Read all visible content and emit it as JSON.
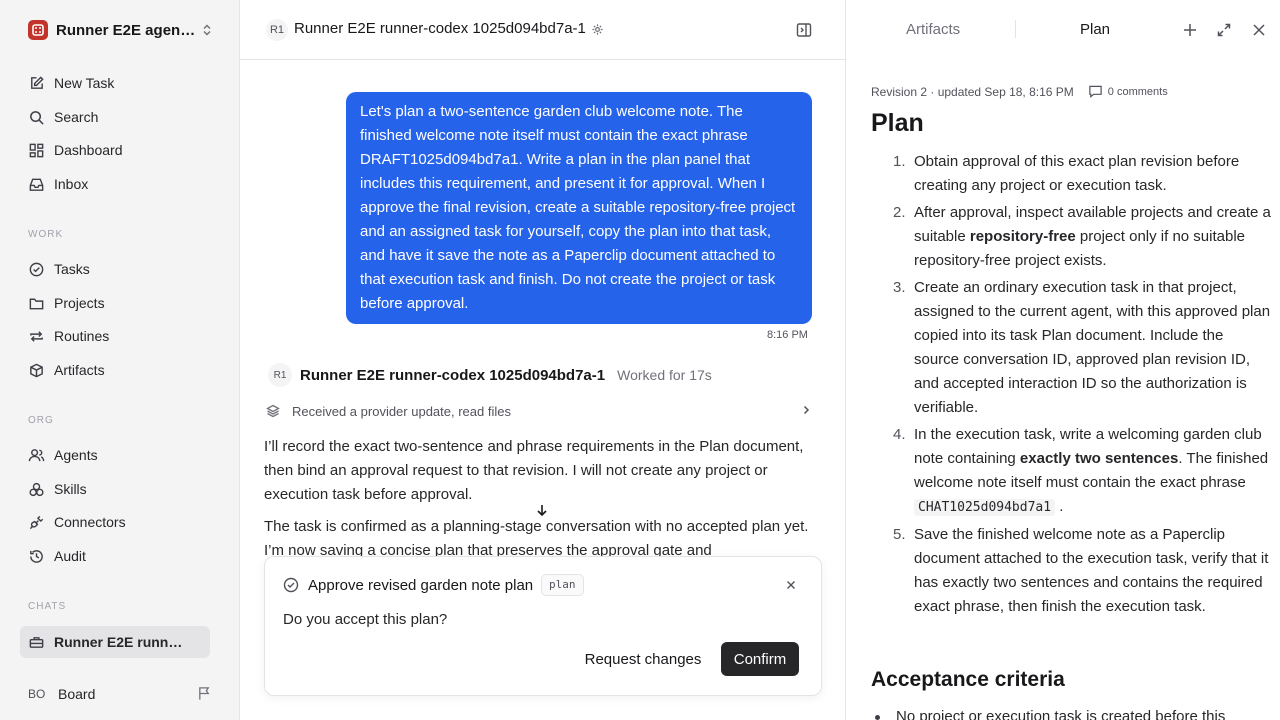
{
  "workspace": {
    "name": "Runner E2E agen…"
  },
  "nav": {
    "new_task": "New Task",
    "search": "Search",
    "dashboard": "Dashboard",
    "inbox": "Inbox"
  },
  "sections": {
    "work": "WORK",
    "org": "ORG",
    "chats": "CHATS"
  },
  "work_nav": {
    "tasks": "Tasks",
    "projects": "Projects",
    "routines": "Routines",
    "artifacts": "Artifacts"
  },
  "org_nav": {
    "agents": "Agents",
    "skills": "Skills",
    "connectors": "Connectors",
    "audit": "Audit"
  },
  "chats": {
    "active": "Runner E2E runn…"
  },
  "board": {
    "initials": "BO",
    "label": "Board"
  },
  "chat": {
    "avatar": "R1",
    "title": "Runner E2E runner-codex 1025d094bd7a-1",
    "user_message": "Let's plan a two-sentence garden club welcome note. The finished welcome note itself must contain the exact phrase DRAFT1025d094bd7a1. Write a plan in the plan panel that includes this requirement, and present it for approval. When I approve the final revision, create a suitable repository-free project and an assigned task for yourself, copy the plan into that task, and have it save the note as a Paperclip document attached to that execution task and finish. Do not create the project or task before approval.",
    "time": "8:16 PM",
    "agent_name": "Runner E2E runner-codex 1025d094bd7a-1",
    "worked": "Worked for 17s",
    "update": "Received a provider update, read files",
    "reply_1": "I’ll record the exact two-sentence and phrase requirements in the Plan document, then bind an approval request to that revision. I will not create any project or execution task before approval.",
    "reply_2": "The task is confirmed as a planning-stage conversation with no accepted plan yet. I’m now saving a concise plan that preserves the approval gate and"
  },
  "approval": {
    "title": "Approve revised garden note plan",
    "tag": "plan",
    "question": "Do you accept this plan?",
    "request_changes": "Request changes",
    "confirm": "Confirm"
  },
  "panel": {
    "tab_artifacts": "Artifacts",
    "tab_plan": "Plan",
    "revision": "Revision 2 · updated Sep 18, 8:16 PM",
    "comments": "0 comments",
    "title": "Plan",
    "steps": {
      "s1": {
        "num": "1.",
        "text": "Obtain approval of this exact plan revision before creating any project or execution task."
      },
      "s2": {
        "num": "2.",
        "a": "After approval, inspect available projects and create a suitable ",
        "b": "repository-free",
        "c": " project only if no suitable repository-free project exists."
      },
      "s3": {
        "num": "3.",
        "text": "Create an ordinary execution task in that project, assigned to the current agent, with this approved plan copied into its task Plan document. Include the source conversation ID, approved plan revision ID, and accepted interaction ID so the authorization is verifiable."
      },
      "s4": {
        "num": "4.",
        "a": "In the execution task, write a welcoming garden club note containing ",
        "b": "exactly two sentences",
        "c": ". The finished welcome note itself must contain the exact phrase ",
        "code": "CHAT1025d094bd7a1",
        "d": " ."
      },
      "s5": {
        "num": "5.",
        "text": "Save the finished welcome note as a Paperclip document attached to the execution task, verify that it has exactly two sentences and contains the required exact phrase, then finish the execution task."
      }
    },
    "acceptance_title": "Acceptance criteria",
    "acceptance_first": "No project or execution task is created before this"
  }
}
